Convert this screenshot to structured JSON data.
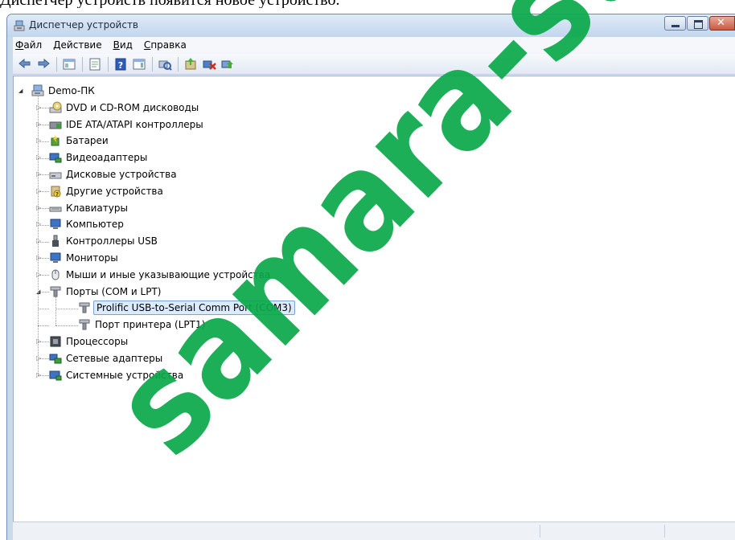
{
  "top_text": "Диспетчер устройств появится новое устройство.",
  "window": {
    "title": "Диспетчер устройств"
  },
  "menu": [
    {
      "label": "Файл",
      "accel": "Ф",
      "rest": "айл"
    },
    {
      "label": "Действие",
      "accel": "Д",
      "rest": "ействие"
    },
    {
      "label": "Вид",
      "accel": "В",
      "rest": "ид"
    },
    {
      "label": "Справка",
      "accel": "С",
      "rest": "правка"
    }
  ],
  "toolbar": [
    "back-arrow-icon",
    "forward-arrow-icon",
    "|",
    "show-hide-console-tree-icon",
    "|",
    "properties-icon",
    "|",
    "help-icon",
    "view-icon",
    "|",
    "scan-hardware-icon",
    "|",
    "update-driver-icon",
    "disable-device-icon",
    "uninstall-device-icon"
  ],
  "tree": {
    "root": "Demo-ПК",
    "categories": [
      {
        "label": "DVD и CD-ROM дисководы",
        "icon": "dvd-drive-icon"
      },
      {
        "label": "IDE ATA/ATAPI контроллеры",
        "icon": "ide-controller-icon"
      },
      {
        "label": "Батареи",
        "icon": "battery-icon"
      },
      {
        "label": "Видеоадаптеры",
        "icon": "display-adapter-icon"
      },
      {
        "label": "Дисковые устройства",
        "icon": "disk-drive-icon"
      },
      {
        "label": "Другие устройства",
        "icon": "unknown-device-icon"
      },
      {
        "label": "Клавиатуры",
        "icon": "keyboard-icon"
      },
      {
        "label": "Компьютер",
        "icon": "computer-icon"
      },
      {
        "label": "Контроллеры USB",
        "icon": "usb-icon"
      },
      {
        "label": "Мониторы",
        "icon": "monitor-icon"
      },
      {
        "label": "Мыши и иные указывающие устройства",
        "icon": "mouse-icon"
      },
      {
        "label": "Порты (COM и LPT)",
        "icon": "port-icon",
        "expanded": true,
        "children": [
          {
            "label": "Prolific USB-to-Serial Comm Port (COM3)",
            "icon": "port-icon",
            "selected": true
          },
          {
            "label": "Порт принтера (LPT1)",
            "icon": "port-icon"
          }
        ]
      },
      {
        "label": "Процессоры",
        "icon": "processor-icon"
      },
      {
        "label": "Сетевые адаптеры",
        "icon": "network-adapter-icon"
      },
      {
        "label": "Системные устройства",
        "icon": "system-devices-icon"
      }
    ]
  },
  "watermark": {
    "text": "samara-st",
    "color": "#0aa94a"
  }
}
